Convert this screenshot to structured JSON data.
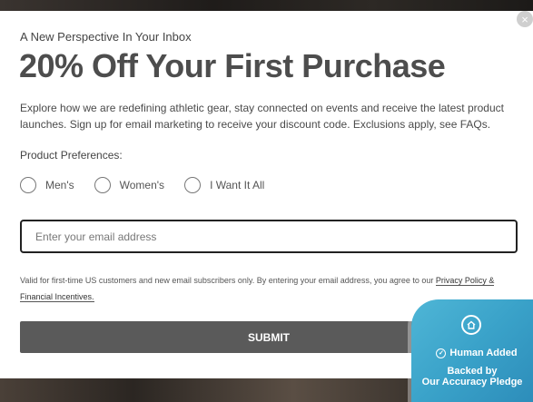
{
  "modal": {
    "close_label": "×",
    "eyebrow": "A New Perspective In Your Inbox",
    "headline": "20% Off Your First Purchase",
    "description": "Explore how we are redefining athletic gear, stay connected on events and receive the latest product launches. Sign up for email marketing to receive your discount code. Exclusions apply, see FAQs.",
    "preferences_label": "Product Preferences:",
    "preferences": [
      {
        "label": "Men's",
        "selected": false
      },
      {
        "label": "Women's",
        "selected": false
      },
      {
        "label": "I Want It All",
        "selected": false
      }
    ],
    "email": {
      "value": "",
      "placeholder": "Enter your email address"
    },
    "legal_text": "Valid for first-time US customers and new email subscribers only. By entering your email address, you agree to our ",
    "legal_link": "Privacy Policy &  Financial Incentives.",
    "submit_label": "SUBMIT"
  },
  "badge": {
    "icon": "home-icon",
    "title": "Human Added",
    "line1": "Backed by",
    "line2": "Our Accuracy Pledge",
    "color": "#3aa2c9"
  }
}
